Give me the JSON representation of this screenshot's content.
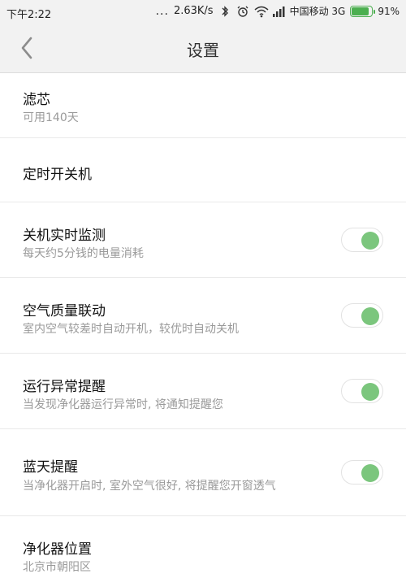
{
  "status_bar": {
    "time": "下午2:22",
    "dots": "...",
    "net_speed": "2.63K/s",
    "carrier": "中国移动 3G",
    "battery_percent": "91%",
    "battery_level": 0.91
  },
  "header": {
    "title": "设置",
    "back_icon": "chevron-left-icon"
  },
  "settings": [
    {
      "label": "滤芯",
      "desc": "可用140天",
      "toggle": null
    },
    {
      "label": "定时开关机",
      "desc": "",
      "toggle": null
    },
    {
      "label": "关机实时监测",
      "desc": "每天约5分钱的电量消耗",
      "toggle": true
    },
    {
      "label": "空气质量联动",
      "desc": "室内空气较差时自动开机，较优时自动关机",
      "toggle": true
    },
    {
      "label": "运行异常提醒",
      "desc": "当发现净化器运行异常时, 将通知提醒您",
      "toggle": true
    },
    {
      "label": "蓝天提醒",
      "desc": "当净化器开启时, 室外空气很好, 将提醒您开窗透气",
      "toggle": true
    },
    {
      "label": "净化器位置",
      "desc": "北京市朝阳区",
      "toggle": null
    }
  ],
  "colors": {
    "toggle_on": "#7bc67d",
    "battery": "#4caf50"
  }
}
